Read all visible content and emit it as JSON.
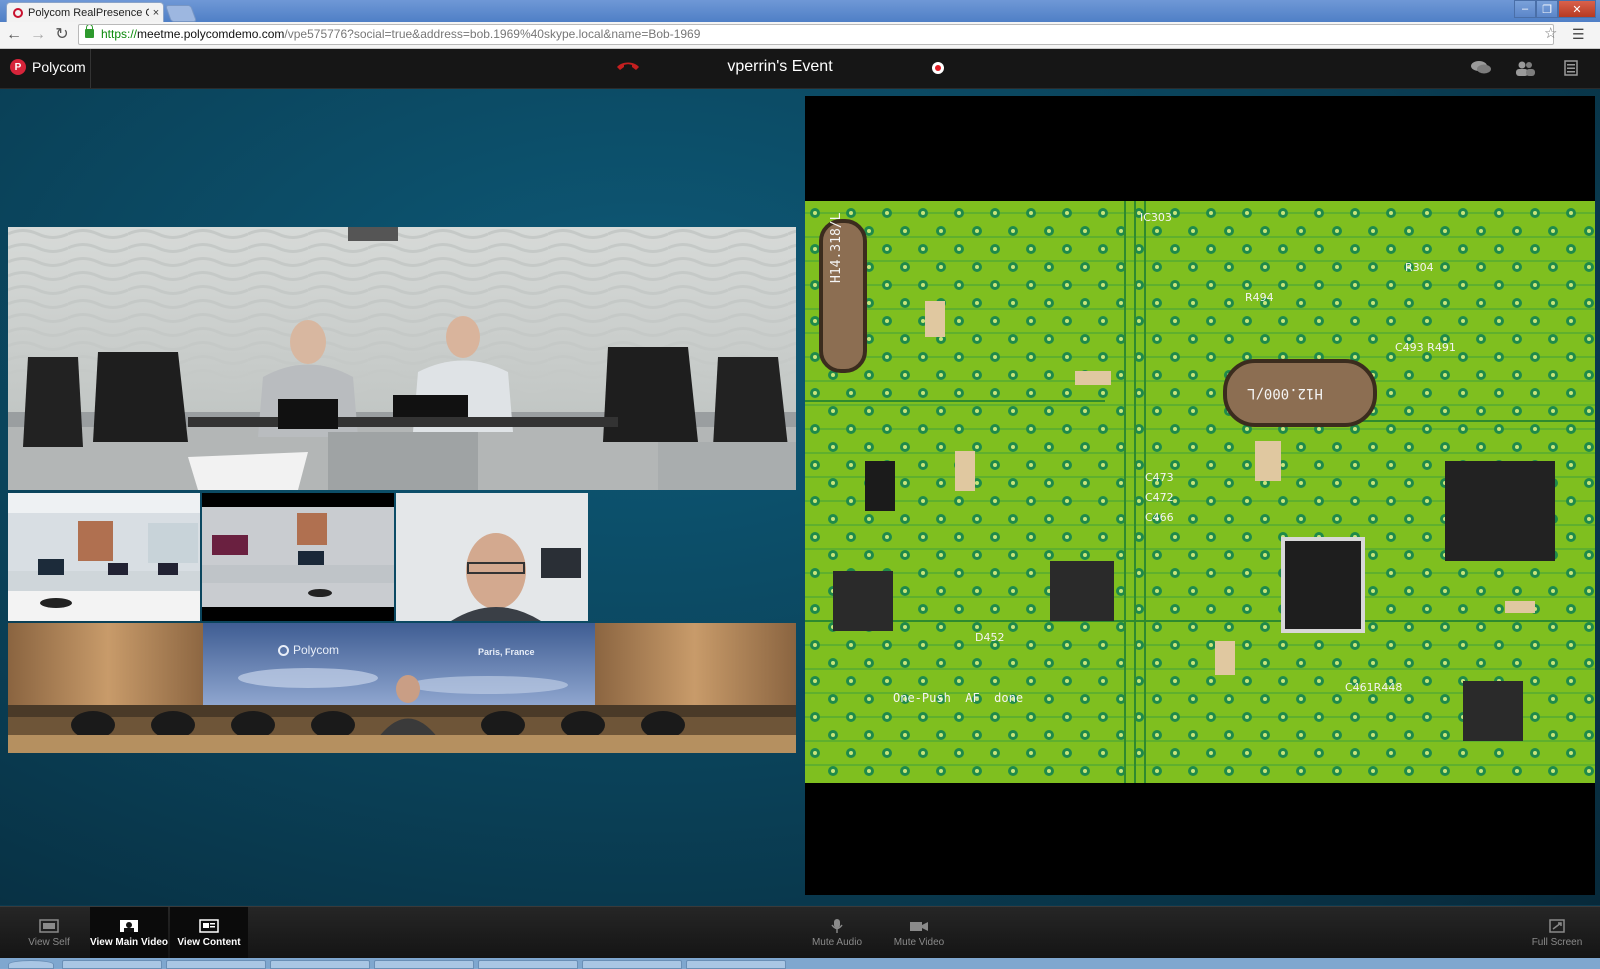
{
  "browser": {
    "tab_title": "Polycom RealPresence Cl",
    "tab_close": "×",
    "url_secure": "https://",
    "url_host": "meetme.polycomdemo.com",
    "url_path": "/vpe575776?social=true&address=bob.1969%40skype.local&name=Bob-1969"
  },
  "app": {
    "logo_text": "Polycom",
    "event_title": "vperrin's Event"
  },
  "video": {
    "tile_banner_logo": "Polycom",
    "tile_banner_location": "Paris, France"
  },
  "content": {
    "overlay_text": "One-Push  AF  done",
    "crystal_label_1": "H14.318/L",
    "crystal_label_2": "H12.000/L"
  },
  "footer": {
    "view_self": "View Self",
    "view_main_video": "View Main Video",
    "view_content": "View Content",
    "mute_audio": "Mute Audio",
    "mute_video": "Mute Video",
    "full_screen": "Full Screen"
  },
  "colors": {
    "accent_red": "#d6243a",
    "stage_blue": "#0a4158",
    "pcb_green": "#7fbf1f"
  }
}
